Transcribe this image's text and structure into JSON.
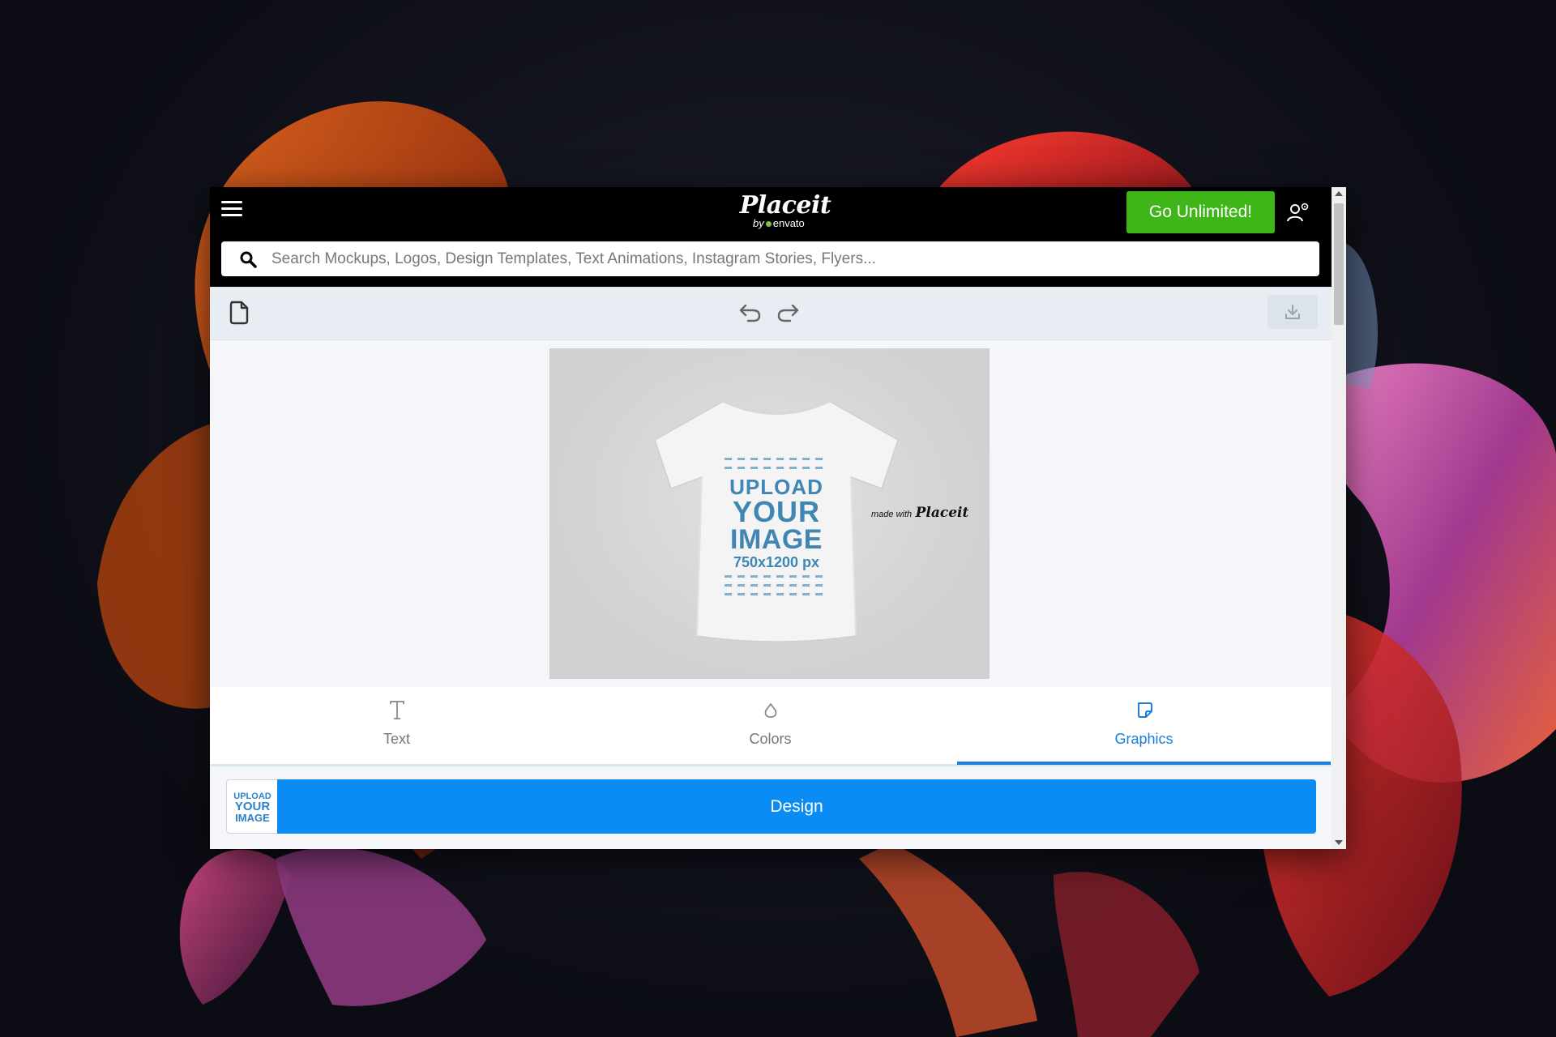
{
  "header": {
    "logo_main": "Placeit",
    "logo_by": "by",
    "logo_brand": "envato",
    "cta_label": "Go Unlimited!"
  },
  "search": {
    "placeholder": "Search Mockups, Logos, Design Templates, Text Animations, Instagram Stories, Flyers..."
  },
  "mockup": {
    "print_line1": "UPLOAD",
    "print_line2": "YOUR",
    "print_line3": "IMAGE",
    "print_line4": "750x1200 px",
    "watermark_small": "made with",
    "watermark_brand": "Placeit"
  },
  "tabs": [
    {
      "label": "Text",
      "icon": "text-icon",
      "active": false
    },
    {
      "label": "Colors",
      "icon": "drop-icon",
      "active": false
    },
    {
      "label": "Graphics",
      "icon": "sticker-icon",
      "active": true
    }
  ],
  "design": {
    "thumb_line1": "UPLOAD",
    "thumb_line2": "YOUR",
    "thumb_line3": "IMAGE",
    "button_label": "Design"
  },
  "colors": {
    "accent": "#0b8cf5",
    "cta": "#3fb618",
    "active_tab": "#1b7fd9"
  }
}
